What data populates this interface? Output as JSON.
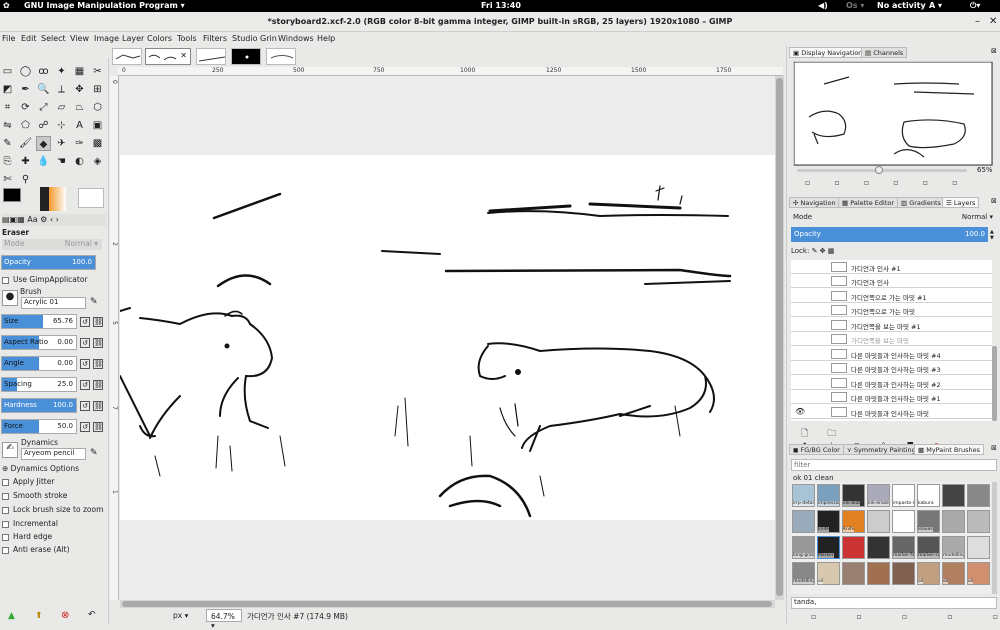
{
  "topbar": {
    "activities_icon": "gnome-foot-icon",
    "app_menu": "GNU Image Manipulation Program ▾",
    "clock": "Fri 13:40",
    "status": "No activity",
    "kbd": "A ▾",
    "os": "Os ▾"
  },
  "window": {
    "title": "*storyboard2.xcf-2.0 (RGB color 8-bit gamma integer, GIMP built-in sRGB, 25 layers) 1920x1080 – GIMP"
  },
  "menu": [
    "File",
    "Edit",
    "Select",
    "View",
    "Image",
    "Layer",
    "Colors",
    "Tools",
    "Filters",
    "Studio Grin",
    "Windows",
    "Help"
  ],
  "tool_options": {
    "title": "Eraser",
    "mode_label": "Mode",
    "mode_value": "Normal ▾",
    "opacity_label": "Opacity",
    "opacity_value": "100.0",
    "opacity_fill": 1.0,
    "use_applicator": "Use GimpApplicator",
    "brush_label": "Brush",
    "brush_value": "Acrylic 01",
    "size_label": "Size",
    "size_value": "65.76",
    "size_fill": 0.55,
    "aspect_label": "Aspect Ratio",
    "aspect_value": "0.00",
    "aspect_fill": 0.5,
    "angle_label": "Angle",
    "angle_value": "0.00",
    "angle_fill": 0.5,
    "spacing_label": "Spacing",
    "spacing_value": "25.0",
    "spacing_fill": 0.2,
    "hardness_label": "Hardness",
    "hardness_value": "100.0",
    "hardness_fill": 1.0,
    "force_label": "Force",
    "force_value": "50.0",
    "force_fill": 0.5,
    "dynamics_label": "Dynamics",
    "dynamics_value": "Aryeom pencil",
    "dynamics_options": "Dynamics Options",
    "checks": [
      "Apply Jitter",
      "Smooth stroke",
      "Lock brush size to zoom",
      "Incremental",
      "Hard edge",
      "Anti erase  (Alt)"
    ]
  },
  "ruler_h": [
    "0",
    "250",
    "500",
    "750",
    "1000",
    "1250",
    "1500",
    "1750"
  ],
  "ruler_v": [
    "0",
    "2",
    "5",
    "7",
    "1"
  ],
  "status": {
    "unit": "px ▾",
    "zoom": "64.7% ▾",
    "message": "가디언가 인사 #7 (174.9 MB)"
  },
  "navigation": {
    "tab1": "Display Navigation",
    "tab2": "Channels",
    "zoom": "65%"
  },
  "layers_panel": {
    "tabs": [
      "Navigation",
      "Palette Editor",
      "Gradients",
      "Layers"
    ],
    "mode_label": "Mode",
    "mode_value": "Normal ▾",
    "opacity_label": "Opacity",
    "opacity_value": "100.0",
    "lock_label": "Lock:",
    "layers": [
      "가디언과 인사 #1",
      "가디언과 인사",
      "가디언쪽으로 가는 마밋 #1",
      "가디언쪽으로 가는 마밋",
      "가디언쪽을 보는 마밋 #1",
      "가디언쪽을 보는 마밋",
      "다른 마밋들과 인사하는 마밋 #4",
      "다른 마밋들과 인사하는 마밋 #3",
      "다른 마밋들과 인사하는 마밋 #2",
      "다른 마밋들과 인사하는 마밋 #1",
      "다른 마밋들과 인사하는 마밋"
    ]
  },
  "brushes_panel": {
    "tabs": [
      "FG/BG Color",
      "Symmetry Painting",
      "MyPaint Brushes"
    ],
    "filter_placeholder": "filter",
    "current": "ok 01 clean",
    "brushes": [
      "",
      "",
      "",
      "",
      "",
      "",
      "",
      "",
      "irrp-details",
      "impressionism",
      "ink-blot",
      "ink-eraser",
      "impasto-ink",
      "kabura",
      "",
      "",
      "",
      "",
      "knife",
      "",
      "",
      "leaves",
      "",
      "",
      "long-grass",
      "Marker",
      "",
      "",
      "marker-fat",
      "marker-small",
      "modelling",
      "",
      "modelling",
      "oil",
      "",
      "",
      "",
      "oil",
      "oil",
      "oil"
    ],
    "tag_value": "tanda,"
  }
}
